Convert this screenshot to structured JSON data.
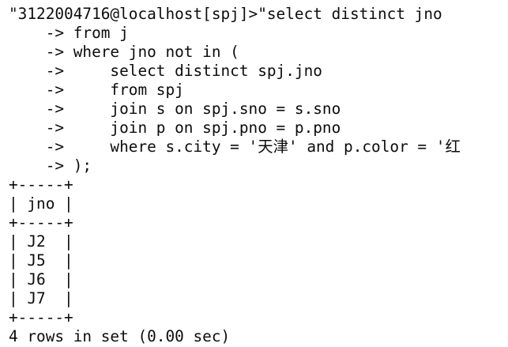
{
  "terminal": {
    "lines": [
      "\"3122004716@localhost[spj]>\"select distinct jno",
      "    -> from j",
      "    -> where jno not in (",
      "    ->     select distinct spj.jno",
      "    ->     from spj",
      "    ->     join s on spj.sno = s.sno",
      "    ->     join p on spj.pno = p.pno",
      "    ->     where s.city = '天津' and p.color = '红",
      "    -> );",
      "+-----+",
      "| jno |",
      "+-----+",
      "| J2  |",
      "| J5  |",
      "| J6  |",
      "| J7  |",
      "+-----+",
      "4 rows in set (0.00 sec)"
    ]
  },
  "colors": {
    "background": "#ffffff",
    "text": "#0c0c0c"
  }
}
